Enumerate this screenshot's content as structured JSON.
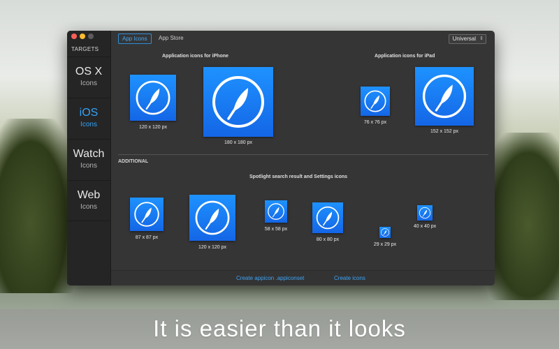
{
  "sidebar": {
    "heading": "TARGETS",
    "items": [
      {
        "title": "OS X",
        "subtitle": "Icons"
      },
      {
        "title": "iOS",
        "subtitle": "Icons"
      },
      {
        "title": "Watch",
        "subtitle": "Icons"
      },
      {
        "title": "Web",
        "subtitle": "Icons"
      }
    ],
    "active_index": 1
  },
  "tabs": [
    {
      "label": "App Icons"
    },
    {
      "label": "App Store"
    }
  ],
  "device_select": {
    "value": "Universal"
  },
  "sections": {
    "iphone": {
      "label": "Application icons for iPhone",
      "sizes": [
        "120 x 120 px",
        "180 x 180 px"
      ]
    },
    "ipad": {
      "label": "Application icons for iPad",
      "sizes": [
        "76 x 76 px",
        "152 x 152 px"
      ]
    },
    "additional_heading": "ADDITIONAL",
    "spotlight": {
      "label": "Spotlight search result and Settings icons",
      "sizes": [
        "87 x 87 px",
        "120 x 120 px",
        "58 x 58 px",
        "80 x 80 px",
        "29 x 29 px",
        "40 x 40 px"
      ]
    }
  },
  "footer": {
    "create_appiconset": "Create appicon .appiconset",
    "create_icons": "Create icons"
  },
  "banner": {
    "text": "It is easier than it looks"
  },
  "colors": {
    "accent": "#35a3f5",
    "icon_top": "#1e92ff",
    "icon_bottom": "#1466e6"
  },
  "icon_glyph": "feather-icon"
}
